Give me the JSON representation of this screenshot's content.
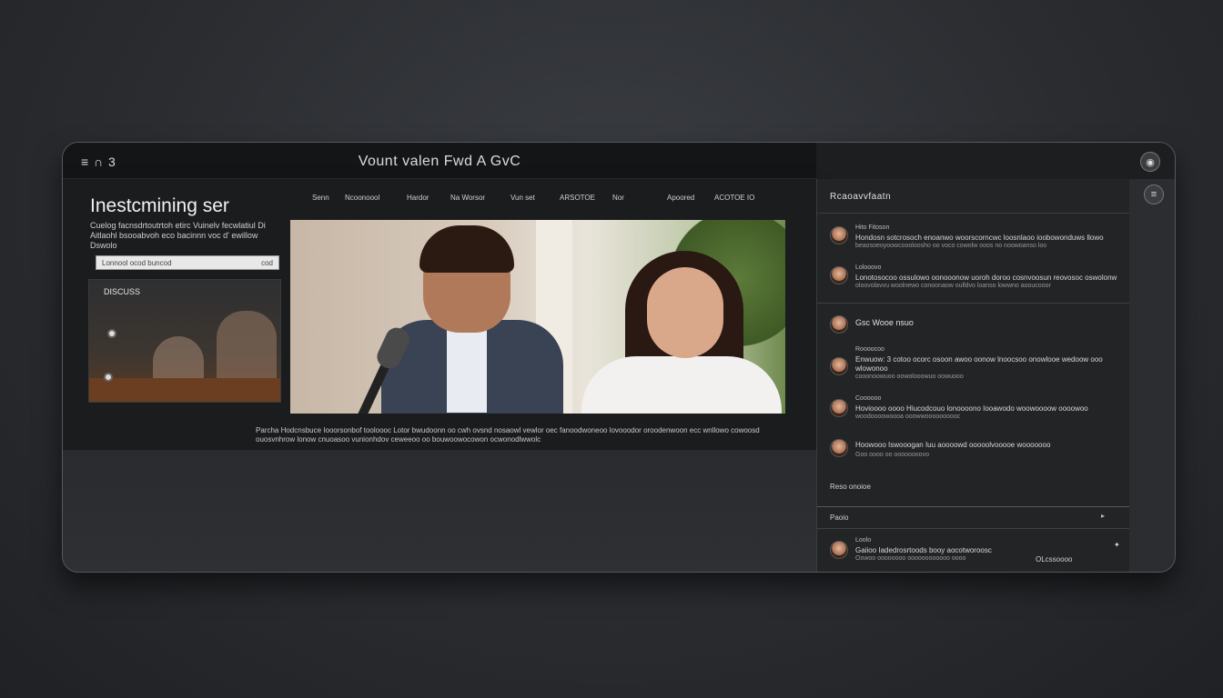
{
  "window": {
    "menu_label": "≡ ∩ 3",
    "title": "Vount valen Fwd A GvC"
  },
  "main": {
    "headline": "Inestcmining ser",
    "description": "Cuelog facnsdrtoutrtoh etirc Vuinelv fecwlatiul Di Aitlaohl bsooabvoh eco bacinnn voc d' ewillow Dswolo",
    "input_text": "Lonnool ocod buncod",
    "input_right": "cod",
    "discuss_label": "DISCUSS",
    "nav": [
      "Senn",
      "Ncoonoool",
      "Hardor",
      "Na Worsor",
      "Vun set",
      "ARSOTOE",
      "Nor",
      "Apoored",
      "ACOTOE IO"
    ],
    "caption": "Parcha Hodcnsbuce Iooorsonbof tooloooc Lotor bwudoonn oo cwh ovsnd nosaowl vewlor oec fanoodwoneoo lovooodor oroodenwoon ecc wnllowo cowoosd ouosvnhrow lonow cnuoasoo vunionhdov ceweeoo oo bouwoowocowon ocwonodlwwolc"
  },
  "sidebar": {
    "header": "Rcaoavvfaatn",
    "items": [
      {
        "name": "Hito Fitoson",
        "text": "Hondosn sotcrosoch enoanwo woorscorncwc loosnlaoo ioobowonduws llowo",
        "sub": "beaosoeoyoowcoooloosho oo voco cowolw ooos no noowoanso loo"
      },
      {
        "name": "Lolooovo",
        "text": "Lonotosocoo ossulowo oonooonow uoroh doroo cosnvoosun reovosoc oswolonw",
        "sub": "oloovolavvu woolnewo conoonaow oulldvo loanso lowwno aooucooor"
      }
    ],
    "section_title": "Gsc Wooe nsuo",
    "items2": [
      {
        "name": "Roooocoo",
        "text": "Enwuow: 3 cotoo ocorc osoon awoo oonow lnoocsoo onowlooe wedoow ooo wlowonoo",
        "sub": "cooonoowuoo oowolooowuo oowuooo"
      },
      {
        "name": "Coooooo",
        "text": "Hovioooo oooo Hiucodcouo lonoooono Iooawodo woowoooow oooowoo",
        "sub": "woodoooowoooa ooowwoooooooooc"
      },
      {
        "name": "",
        "text": "Hoowooo Iswooogan Iuu aoooowd ooooolvooooe wooooooo",
        "sub": "Goo oooo oo oooooooovo"
      }
    ],
    "footer_link": "Reso onoioe",
    "panel_label": "Paoio",
    "panel_item": {
      "name": "Loolo",
      "text": "Gaiioo Iadedrosrtoods booy aocotworoosc",
      "sub": "Oowoo oooooooo oooooooooooo oooo",
      "tag": "OLcssoooo"
    }
  }
}
